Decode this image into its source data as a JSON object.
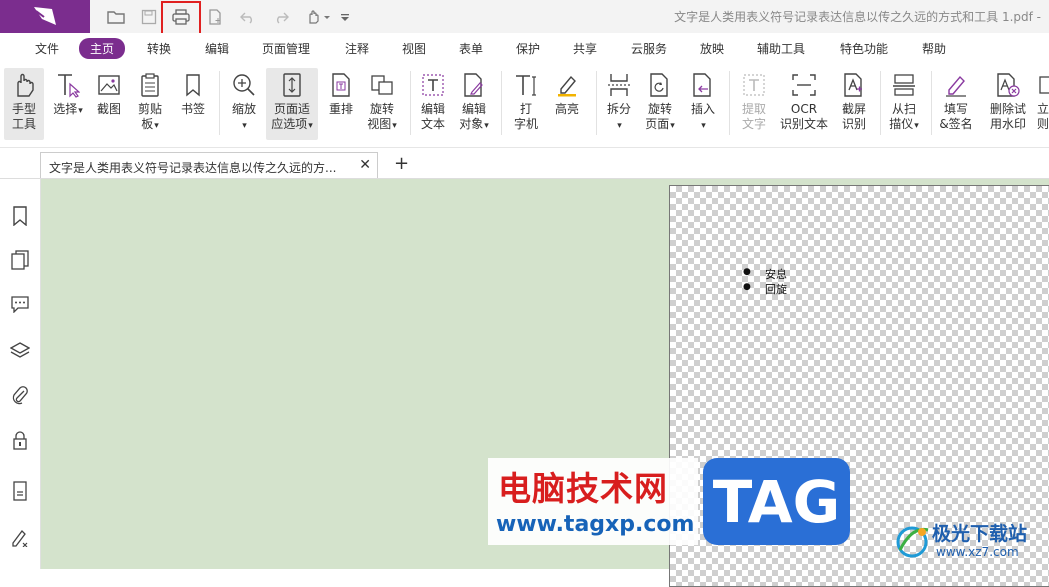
{
  "titlebar": {
    "document_title": "文字是人类用表义符号记录表达信息以传之久远的方式和工具 1.pdf -",
    "quick_access": [
      "open-icon",
      "save-icon",
      "print-icon",
      "new-icon",
      "undo-icon",
      "redo-icon",
      "hand-icon",
      "customize-icon"
    ]
  },
  "menu": [
    "文件",
    "主页",
    "转换",
    "编辑",
    "页面管理",
    "注释",
    "视图",
    "表单",
    "保护",
    "共享",
    "云服务",
    "放映",
    "辅助工具",
    "特色功能",
    "帮助"
  ],
  "menu_active": "主页",
  "ribbon": {
    "hand": "手型",
    "hand2": "工具",
    "select": "选择",
    "snapshot": "截图",
    "clipboard": "剪贴",
    "clipboard2": "板",
    "bookmark": "书签",
    "zoom": "缩放",
    "fit": "页面适",
    "fit2": "应选项",
    "reflow": "重排",
    "rotate_view": "旋转",
    "rotate_view2": "视图",
    "edit_text": "编辑",
    "edit_text2": "文本",
    "edit_obj": "编辑",
    "edit_obj2": "对象",
    "typewriter": "打",
    "typewriter2": "字机",
    "highlight": "高亮",
    "split": "拆分",
    "rotate_page": "旋转",
    "rotate_page2": "页面",
    "insert": "插入",
    "extract": "提取",
    "extract2": "文字",
    "ocr": "OCR",
    "ocr2": "识别文本",
    "screen_ocr": "截屏",
    "screen_ocr2": "识别",
    "scan": "从扫",
    "scan2": "描仪",
    "sign": "填写",
    "sign2": "&签名",
    "watermark": "删除试",
    "watermark2": "用水印",
    "more": "立",
    "more2": "则"
  },
  "tab": {
    "label": "文字是人类用表义符号记录表达信息以传之久远的方...",
    "close": "✕",
    "add": "+"
  },
  "page": {
    "bullets": [
      "安息",
      "回旋"
    ]
  },
  "watermark": {
    "title": "电脑技术网",
    "url": "www.tagxp.com",
    "tag": "TAG"
  },
  "brand": {
    "name": "极光下载站",
    "url": "www.xz7.com"
  },
  "colors": {
    "accent": "#7b2d8e",
    "highlight_box": "#e02020",
    "doc_background": "#d4e3cc"
  }
}
